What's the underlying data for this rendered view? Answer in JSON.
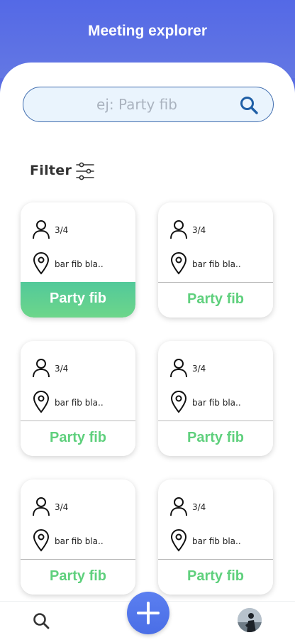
{
  "app": {
    "title": "Meeting explorer"
  },
  "search": {
    "placeholder": "ej: Party fib",
    "value": ""
  },
  "filter": {
    "label": "Filter"
  },
  "cards": [
    {
      "people": "3/4",
      "location": "bar fib bla..",
      "action": "Party fib",
      "active": true
    },
    {
      "people": "3/4",
      "location": "bar fib bla..",
      "action": "Party fib",
      "active": false
    },
    {
      "people": "3/4",
      "location": "bar fib bla..",
      "action": "Party fib",
      "active": false
    },
    {
      "people": "3/4",
      "location": "bar fib bla..",
      "action": "Party fib",
      "active": false
    },
    {
      "people": "3/4",
      "location": "bar fib bla..",
      "action": "Party fib",
      "active": false
    },
    {
      "people": "3/4",
      "location": "bar fib bla..",
      "action": "Party fib",
      "active": false
    }
  ],
  "nav": {
    "items": [
      "search-icon",
      "add-icon",
      "avatar"
    ]
  },
  "colors": {
    "header": "#5a6de3",
    "accent_green": "#5fd07d",
    "fab": "#4f72ea",
    "search_border": "#3f6cae"
  }
}
